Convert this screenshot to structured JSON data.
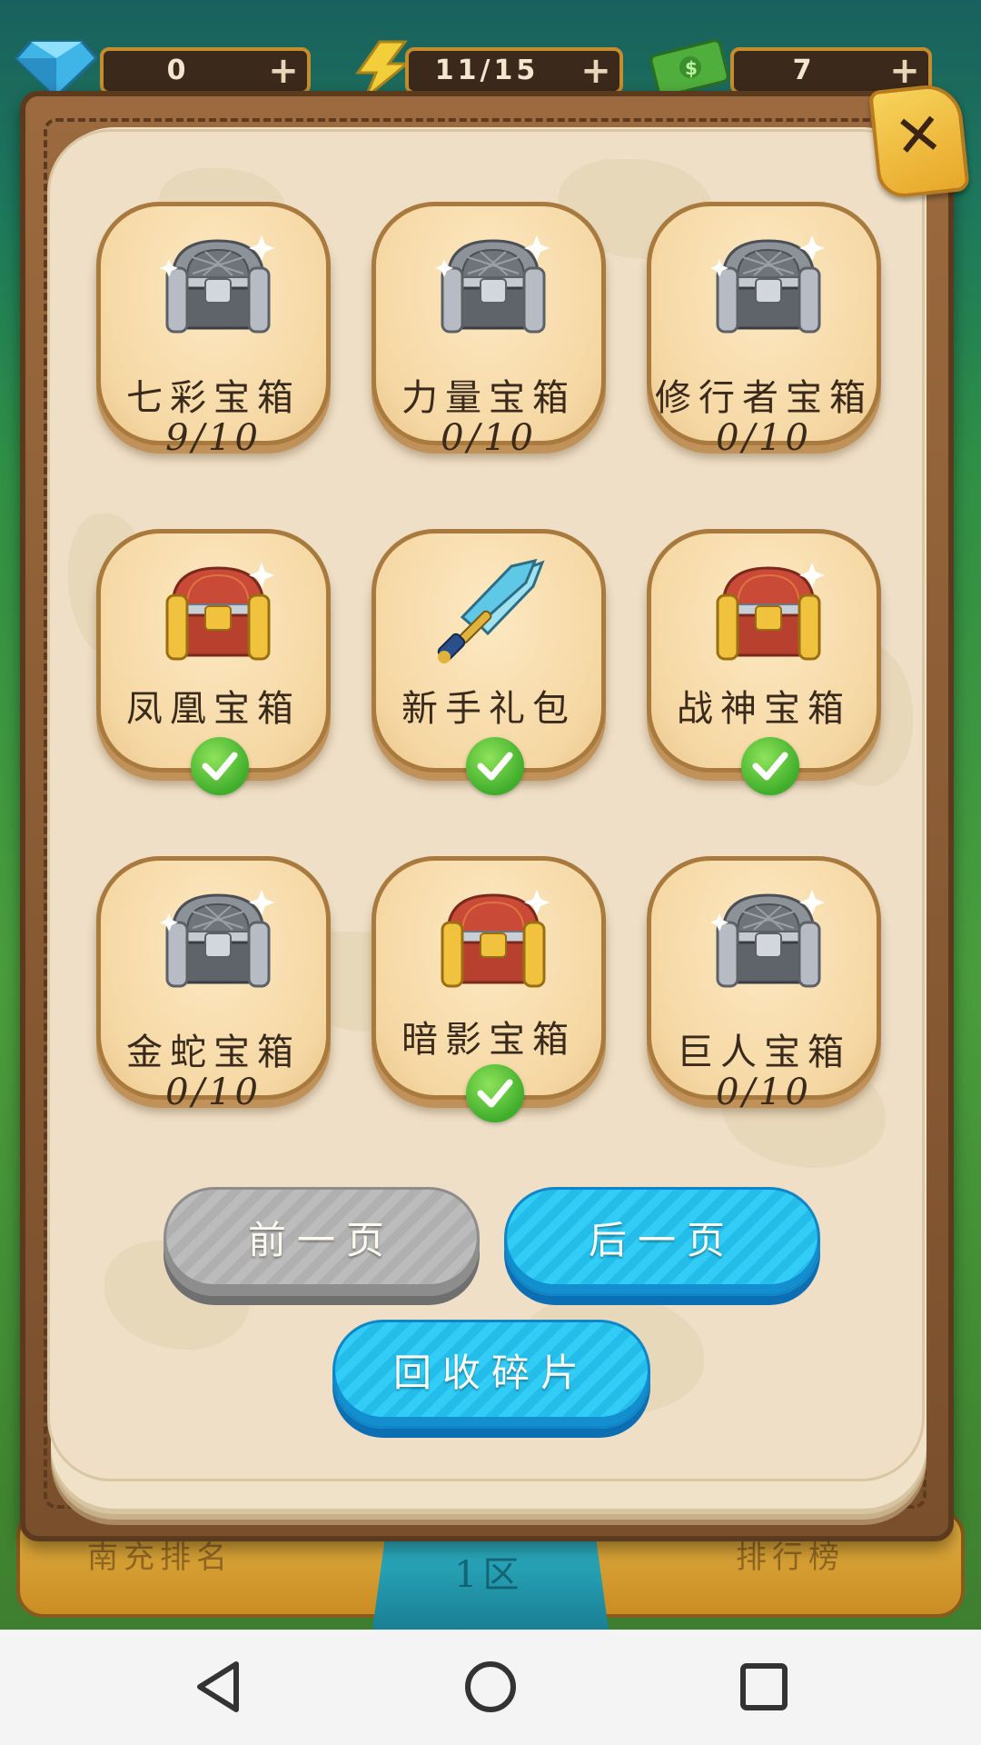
{
  "currency": {
    "gems": "0",
    "energy": "11/15",
    "cash": "7",
    "plus_glyph": "+"
  },
  "background": {
    "left_label": "南充排名",
    "mid_label": "1区",
    "right_label": "排行榜"
  },
  "dialog": {
    "close_glyph": "✕",
    "chests": [
      {
        "name": "七彩宝箱",
        "progress": "9/10",
        "chest_style": "silver",
        "claimed": false
      },
      {
        "name": "力量宝箱",
        "progress": "0/10",
        "chest_style": "silver",
        "claimed": false
      },
      {
        "name": "修行者宝箱",
        "progress": "0/10",
        "chest_style": "silver",
        "claimed": false
      },
      {
        "name": "凤凰宝箱",
        "progress": "",
        "chest_style": "gold",
        "claimed": true
      },
      {
        "name": "新手礼包",
        "progress": "",
        "chest_style": "sword",
        "claimed": true
      },
      {
        "name": "战神宝箱",
        "progress": "",
        "chest_style": "gold",
        "claimed": true
      },
      {
        "name": "金蛇宝箱",
        "progress": "0/10",
        "chest_style": "silver",
        "claimed": false
      },
      {
        "name": "暗影宝箱",
        "progress": "",
        "chest_style": "gold",
        "claimed": true
      },
      {
        "name": "巨人宝箱",
        "progress": "0/10",
        "chest_style": "silver",
        "claimed": false
      }
    ],
    "prev_label": "前一页",
    "next_label": "后一页",
    "recycle_label": "回收碎片"
  },
  "colors": {
    "button_blue": "#24bdea",
    "button_gray": "#b0b0b0",
    "check_green": "#3fae2b"
  },
  "icons": {
    "gem": "gem-icon",
    "energy": "lightning-icon",
    "cash": "cash-icon",
    "check": "check-icon",
    "nav_back": "back-triangle-icon",
    "nav_home": "home-circle-icon",
    "nav_recent": "recent-square-icon"
  }
}
